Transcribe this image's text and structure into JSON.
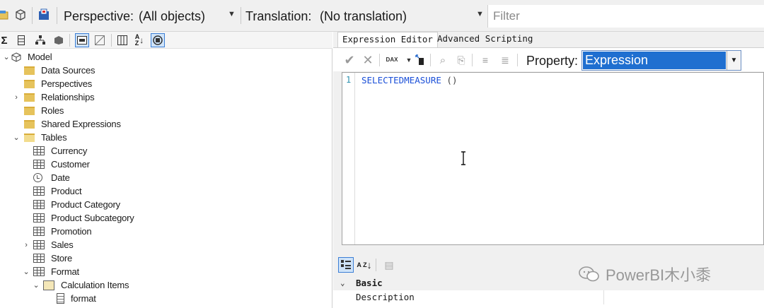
{
  "toolbar": {
    "perspective_label": "Perspective:",
    "perspective_value": "(All objects)",
    "translation_label": "Translation:",
    "translation_value": "(No translation)",
    "filter_placeholder": "Filter"
  },
  "tree": [
    {
      "label": "Model",
      "icon": "model-icon",
      "expander": "expanded"
    },
    {
      "label": "Data Sources",
      "icon": "folder-icon"
    },
    {
      "label": "Perspectives",
      "icon": "folder-icon"
    },
    {
      "label": "Relationships",
      "icon": "folder-icon",
      "expander": "collapsed"
    },
    {
      "label": "Roles",
      "icon": "folder-icon"
    },
    {
      "label": "Shared Expressions",
      "icon": "folder-icon"
    },
    {
      "label": "Tables",
      "icon": "folder-open-icon",
      "expander": "expanded"
    },
    {
      "label": "Currency",
      "icon": "table-icon"
    },
    {
      "label": "Customer",
      "icon": "table-icon"
    },
    {
      "label": "Date",
      "icon": "date-table-icon"
    },
    {
      "label": "Product",
      "icon": "table-icon"
    },
    {
      "label": "Product Category",
      "icon": "table-icon"
    },
    {
      "label": "Product Subcategory",
      "icon": "table-icon"
    },
    {
      "label": "Promotion",
      "icon": "table-icon"
    },
    {
      "label": "Sales",
      "icon": "table-icon",
      "expander": "collapsed"
    },
    {
      "label": "Store",
      "icon": "table-icon"
    },
    {
      "label": "Format",
      "icon": "calculation-group-icon",
      "expander": "expanded"
    },
    {
      "label": "Calculation Items",
      "icon": "calculation-items-icon",
      "expander": "expanded"
    },
    {
      "label": "format",
      "icon": "calculation-item-icon"
    }
  ],
  "tabs": {
    "expression_editor": "Expression Editor",
    "advanced_scripting": "Advanced Scripting"
  },
  "editor_toolbar": {
    "property_label": "Property:",
    "property_value": "Expression",
    "dax_label": "DAX"
  },
  "editor": {
    "line_number": "1",
    "code_function": "SELECTEDMEASURE",
    "code_parens": " ()"
  },
  "properties": {
    "category": "Basic",
    "rows": [
      "Description"
    ],
    "sort_icon_text": "A Z"
  },
  "watermark": "PowerBI木小黍"
}
